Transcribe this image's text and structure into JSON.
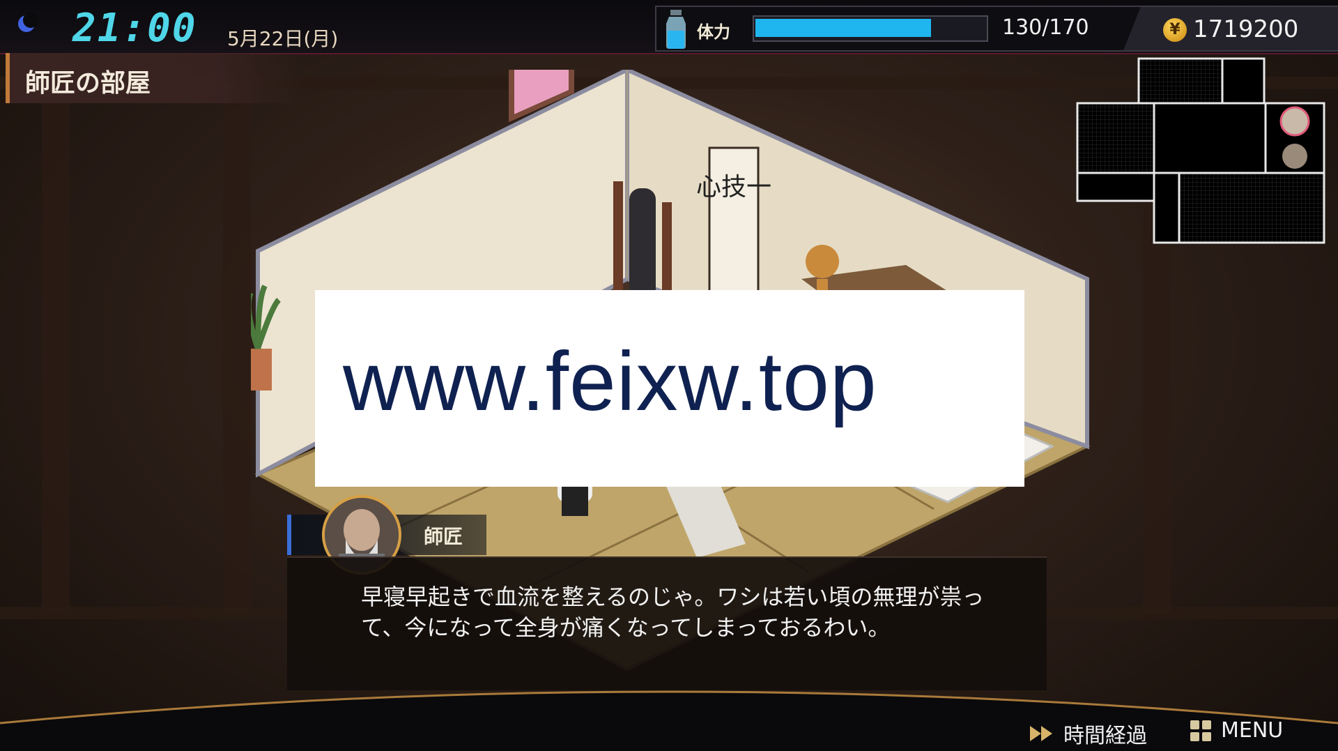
{
  "hud": {
    "time": "21:00",
    "date": "5月22日(月)",
    "stamina_label": "体力",
    "stamina_value": "130/170",
    "stamina_fraction": 0.765,
    "currency_symbol": "¥",
    "money": "1719200",
    "time_of_day_icon": "moon-icon",
    "stamina_icon": "bottle-icon"
  },
  "location": {
    "name": "師匠の部屋"
  },
  "room": {
    "scroll_text": "心技一"
  },
  "watermark": {
    "text": "www.feixw.top"
  },
  "dialogue": {
    "speaker": "師匠",
    "text": "早寝早起きで血流を整えるのじゃ。ワシは若い頃の無理が祟って、今になって全身が痛くなってしまっておるわい。"
  },
  "controls": {
    "skip_label": "時間経過",
    "menu_label": "MENU"
  },
  "colors": {
    "clock": "#4fd6e8",
    "stamina_bar": "#1fb6ef",
    "accent_border": "#d7a045"
  }
}
